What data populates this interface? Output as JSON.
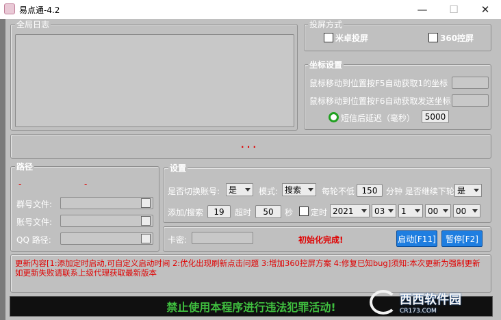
{
  "window": {
    "title": "易点通-4.2",
    "min_icon": "minimize-icon",
    "max_icon": "maximize-icon",
    "close_icon": "close-icon"
  },
  "log_group": {
    "title": "全局日志"
  },
  "cast_group": {
    "title": "投屏方式",
    "mizhuo": "米卓投屏",
    "q360": "360控屏"
  },
  "coord_group": {
    "title": "坐标设置",
    "line1": "鼠标移动到位置按F5自动获取1的坐标",
    "line2": "鼠标移动到位置按F6自动获取发送坐标",
    "delay_label": "短信后延迟（毫秒）",
    "delay_value": "5000"
  },
  "status_dots": "· · ·",
  "path_group": {
    "title": "路径",
    "dash1": "-",
    "dash2": "-",
    "group_file": "群号文件:",
    "account_file": "账号文件:",
    "qq_path": "QQ  路径:"
  },
  "settings_group": {
    "title": "设置",
    "switch_label": "是否切换账号:",
    "switch_value": "是",
    "mode_label": "模式:",
    "mode_value": "搜索",
    "per_round_label": "每轮不低",
    "per_round_value": "150",
    "minutes_label": "分钟 是否继续下轮",
    "continue_value": "是",
    "add_search_label": "添加/搜索",
    "add_search_value": "19",
    "timeout_label": "超时",
    "timeout_value": "50",
    "seconds_label": "秒",
    "timer_label": "定时",
    "year": "2021",
    "month": "03",
    "day": "1",
    "hour": "00",
    "minute": "00"
  },
  "card": {
    "label": "卡密:",
    "init_status": "初始化完成!",
    "start_button": "启动[F11]",
    "pause_button": "暂停[F2]"
  },
  "update_notes": "更新内容[1:添加定时启动,可自定义启动时间  2:优化出现刷新点击问题  3:增加360控屏方案  4:修复已知bug]须知:本次更新为强制更新 如更新失败请联系上级代理获取最新版本",
  "banner": "禁止使用本程序进行违法犯罪活动!",
  "watermark": {
    "text": "西西软件园",
    "sub": "CR173.COM"
  },
  "colors": {
    "accent_button": "#1f7ee0",
    "status_red": "#e00000",
    "banner_text": "#3fbf3f"
  }
}
